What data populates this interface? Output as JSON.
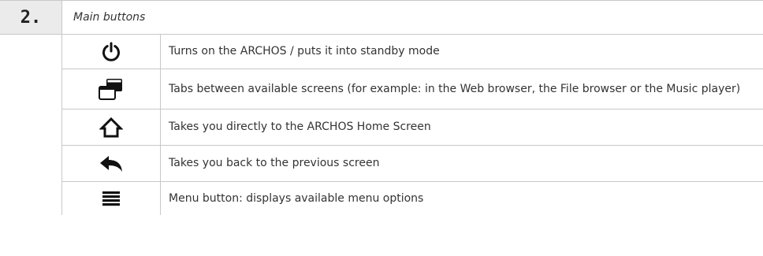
{
  "section": {
    "number": "2.",
    "title": "Main buttons"
  },
  "rows": [
    {
      "icon": "power-icon",
      "description": "Turns on the ARCHOS / puts it into standby mode"
    },
    {
      "icon": "tabs-switch-icon",
      "description": "Tabs between available screens (for example: in the Web browser, the File browser or the Music player)"
    },
    {
      "icon": "home-icon",
      "description": "Takes you directly to the ARCHOS Home Screen"
    },
    {
      "icon": "back-arrow-icon",
      "description": "Takes you back to the previous screen"
    },
    {
      "icon": "menu-icon",
      "description": "Menu button: displays available menu options"
    }
  ]
}
